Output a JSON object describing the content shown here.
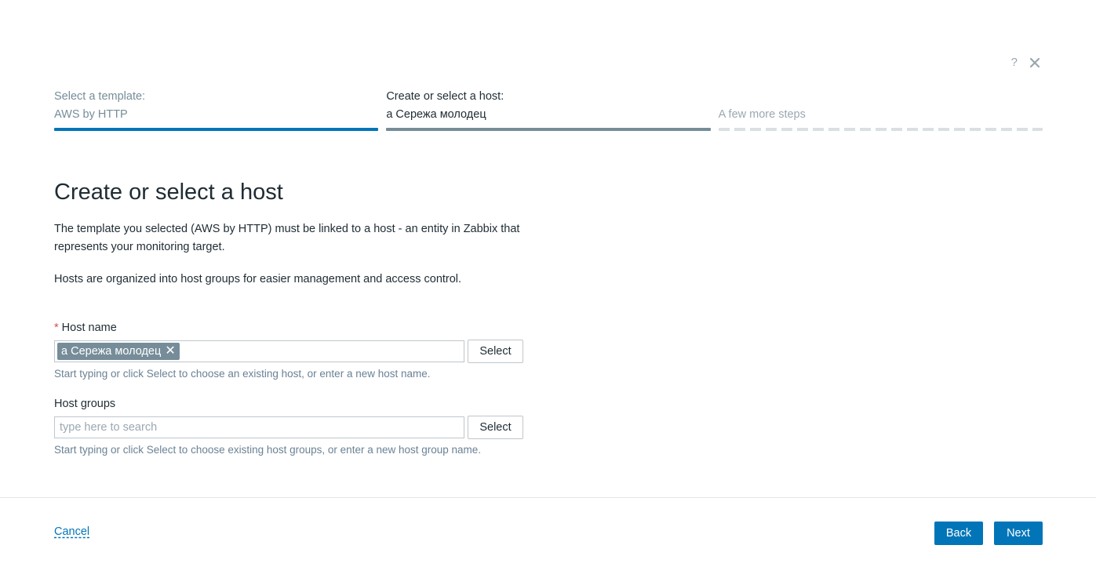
{
  "dialog": {
    "help_label": "?",
    "close_label": "×"
  },
  "steps": [
    {
      "title": "Select a template:",
      "value": "AWS by HTTP",
      "state": "done"
    },
    {
      "title": "Create or select a host:",
      "value": "а Сережа молодец",
      "state": "active"
    },
    {
      "title": "",
      "value": "A few more steps",
      "state": "todo"
    }
  ],
  "main": {
    "title": "Create or select a host",
    "paragraph1": "The template you selected (AWS by HTTP) must be linked to a host - an entity in Zabbix that represents your monitoring target.",
    "paragraph2": "Hosts are organized into host groups for easier management and access control."
  },
  "host_name": {
    "required_mark": "*",
    "label": "Host name",
    "chip": "а Сережа молодец",
    "chip_remove": "✕",
    "select_label": "Select",
    "hint": "Start typing or click Select to choose an existing host, or enter a new host name."
  },
  "host_groups": {
    "label": "Host groups",
    "placeholder": "type here to search",
    "select_label": "Select",
    "hint": "Start typing or click Select to choose existing host groups, or enter a new host group name."
  },
  "footer": {
    "cancel_label": "Cancel",
    "back_label": "Back",
    "next_label": "Next"
  },
  "colors": {
    "accent": "#0275b8",
    "active_step": "#768d99",
    "todo_step": "#d9dfe3",
    "required": "#d64e4e"
  }
}
